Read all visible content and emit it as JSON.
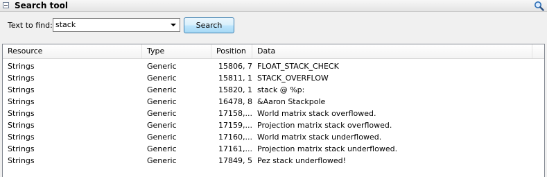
{
  "panel": {
    "title": "Search tool",
    "collapse_icon": "minus-box-icon",
    "search_icon": "magnifier-icon"
  },
  "search": {
    "label": "Text to find:",
    "value": "stack",
    "button_label": "Search"
  },
  "table": {
    "columns": [
      "Resource",
      "Type",
      "Position",
      "Data"
    ],
    "rows": [
      [
        "Strings",
        "Generic",
        "15806, 7",
        "FLOAT_STACK_CHECK"
      ],
      [
        "Strings",
        "Generic",
        "15811, 1",
        "STACK_OVERFLOW"
      ],
      [
        "Strings",
        "Generic",
        "15820, 1",
        "stack @ %p:"
      ],
      [
        "Strings",
        "Generic",
        "16478, 8",
        "&Aaron Stackpole"
      ],
      [
        "Strings",
        "Generic",
        "17158,...",
        "World matrix stack overflowed."
      ],
      [
        "Strings",
        "Generic",
        "17159,...",
        "Projection matrix stack overflowed."
      ],
      [
        "Strings",
        "Generic",
        "17160,...",
        "World matrix stack underflowed."
      ],
      [
        "Strings",
        "Generic",
        "17161,...",
        "Projection matrix stack underflowed."
      ],
      [
        "Strings",
        "Generic",
        "17849, 5",
        "Pez stack underflowed!"
      ]
    ]
  },
  "colors": {
    "button_border": "#3c7fb1",
    "grid_border": "#828790",
    "background": "#f0f0f0"
  }
}
